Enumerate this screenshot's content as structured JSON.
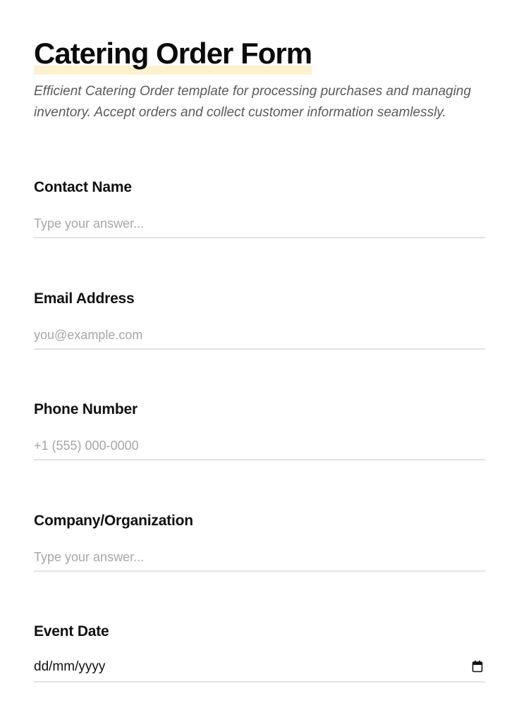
{
  "form": {
    "title": "Catering Order Form",
    "description": "Efficient Catering Order template for processing purchases and managing inventory. Accept orders and collect customer information seamlessly.",
    "highlight_color": "#fdf1cf"
  },
  "fields": {
    "contact_name": {
      "label": "Contact Name",
      "placeholder": "Type your answer...",
      "value": ""
    },
    "email": {
      "label": "Email Address",
      "placeholder": "you@example.com",
      "value": ""
    },
    "phone": {
      "label": "Phone Number",
      "placeholder": "+1 (555) 000-0000",
      "value": ""
    },
    "company": {
      "label": "Company/Organization",
      "placeholder": "Type your answer...",
      "value": ""
    },
    "event_date": {
      "label": "Event Date",
      "display": "dd/mm/yyyy",
      "icon": "calendar-icon"
    }
  }
}
